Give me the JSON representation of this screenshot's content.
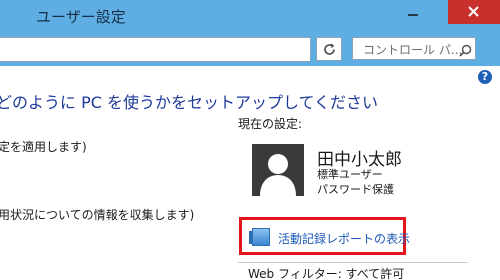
{
  "window": {
    "title": "ユーザー設定"
  },
  "addressbar": {
    "address_value": "",
    "search_placeholder": "コントロール パ..."
  },
  "content": {
    "heading": "どのように PC を使うかをセットアップしてください",
    "left_lines": [
      "定を適用します)",
      "用状況についての情報を収集します)"
    ],
    "current_settings_label": "現在の設定:",
    "user": {
      "name": "田中小太郎",
      "account_type": "標準ユーザー",
      "password_status": "パスワード保護"
    },
    "activity_report_link": "活動記録レポートの表示",
    "web_filter": "Web フィルター: すべて許可"
  },
  "icons": {
    "help": "?",
    "close": "close-icon",
    "minimize": "minimize-icon",
    "refresh": "refresh-icon",
    "search": "search-icon",
    "avatar": "user-avatar-icon",
    "report": "report-book-icon"
  },
  "colors": {
    "titlebar": "#5faee3",
    "close_button": "#c9302c",
    "heading": "#1e3a9a",
    "link": "#1b5bb7",
    "highlight": "#e3141c"
  }
}
